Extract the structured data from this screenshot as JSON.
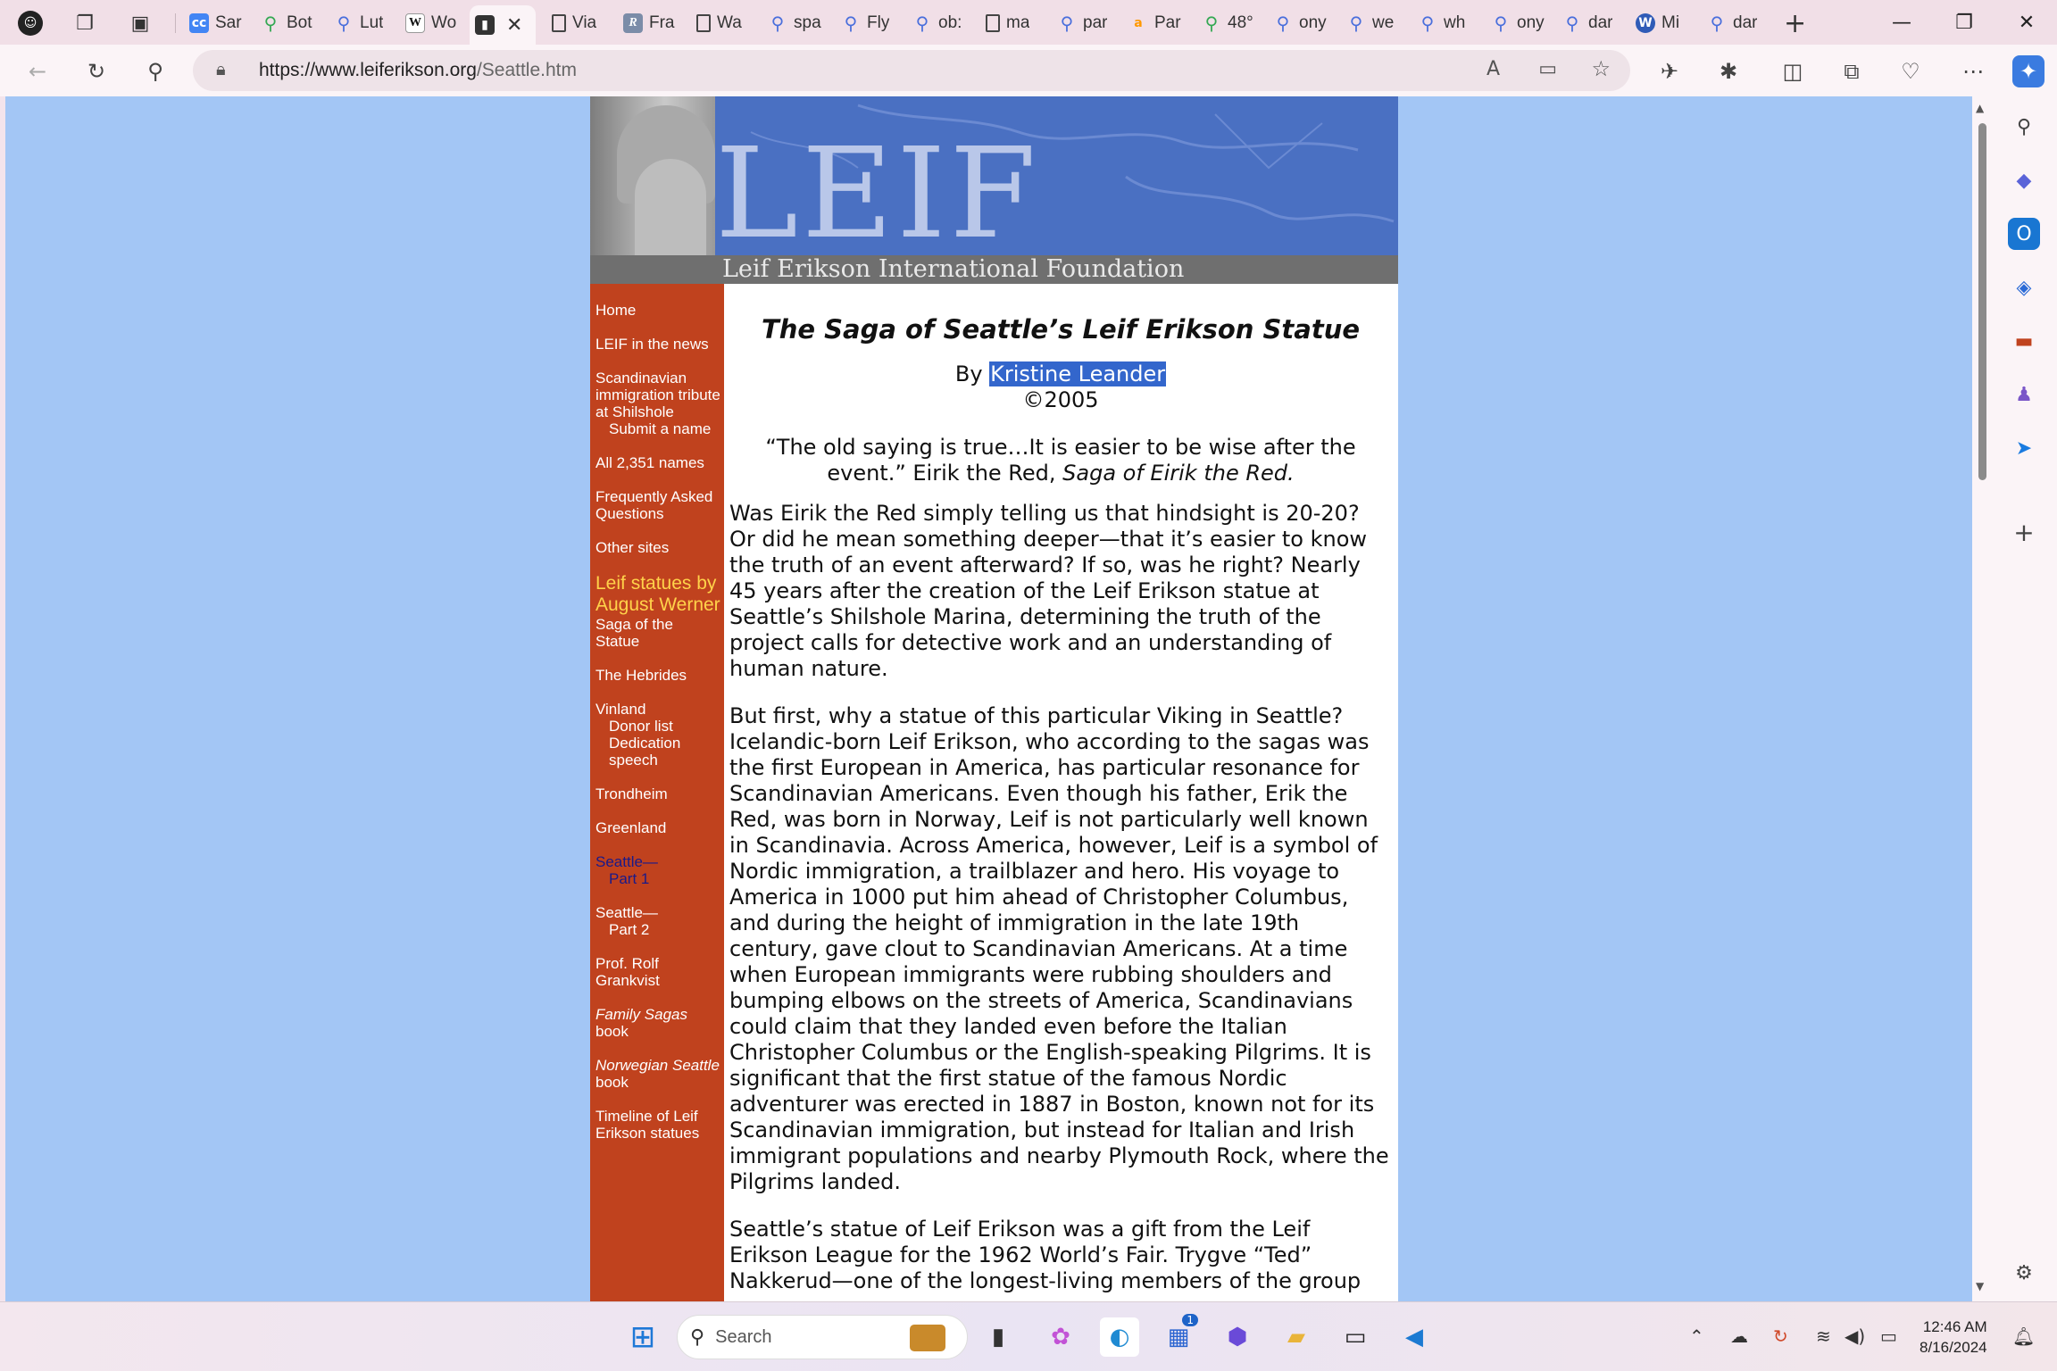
{
  "tabs": [
    {
      "label": "",
      "icon": "profile-avatar-icon"
    },
    {
      "label": "",
      "icon": "workspaces-icon"
    },
    {
      "label": "",
      "icon": "tab-actions-icon"
    },
    {
      "label": "Sar",
      "icon": "cc-icon"
    },
    {
      "label": "Bot",
      "icon": "maps-pin-icon"
    },
    {
      "label": "Lut",
      "icon": "search-icon"
    },
    {
      "label": "Wo",
      "icon": "wikipedia-icon"
    },
    {
      "label": "",
      "icon": "leif-favicon-icon",
      "active": true
    },
    {
      "label": "Via",
      "icon": "document-icon"
    },
    {
      "label": "Fra",
      "icon": "r-icon"
    },
    {
      "label": "Wa",
      "icon": "document-icon"
    },
    {
      "label": "spa",
      "icon": "search-icon"
    },
    {
      "label": "Fly",
      "icon": "search-icon"
    },
    {
      "label": "ob:",
      "icon": "search-icon"
    },
    {
      "label": "ma",
      "icon": "document-icon"
    },
    {
      "label": "par",
      "icon": "search-icon"
    },
    {
      "label": "Par",
      "icon": "amazon-icon"
    },
    {
      "label": "48°",
      "icon": "maps-pin-icon"
    },
    {
      "label": "ony",
      "icon": "search-icon"
    },
    {
      "label": "we",
      "icon": "search-icon"
    },
    {
      "label": "wh",
      "icon": "search-icon"
    },
    {
      "label": "ony",
      "icon": "search-icon"
    },
    {
      "label": "dar",
      "icon": "search-icon"
    },
    {
      "label": "Mi",
      "icon": "wordpress-icon"
    },
    {
      "label": "dar",
      "icon": "search-icon"
    }
  ],
  "browser": {
    "url_host": "https://www.leiferikson.org",
    "url_path": "/Seattle.htm"
  },
  "banner": {
    "leif": "LEIF",
    "org": "Leif Erikson International Foundation"
  },
  "nav": {
    "home": "Home",
    "news": "LEIF in the news",
    "tribute": "Scandinavian immigration tribute at Shilshole",
    "submit": "Submit a name",
    "names": "All 2,351 names",
    "faq": "Frequently Asked Questions",
    "other": "Other sites",
    "statues_heading": "Leif statues by August Werner",
    "saga": "Saga of the Statue",
    "hebrides": "The Hebrides",
    "vinland": "Vinland",
    "donor": "Donor list",
    "dedication": "Dedication speech",
    "trondheim": "Trondheim",
    "greenland": "Greenland",
    "seattle1_a": "Seattle—",
    "seattle1_b": "Part 1",
    "seattle2_a": "Seattle—",
    "seattle2_b": "Part 2",
    "grankvist": "Prof. Rolf Grankvist",
    "family_italic": "Family Sagas",
    "family_rest": " book",
    "norwegian_italic": "Norwegian Seattle",
    "norwegian_rest": " book",
    "timeline": "Timeline of Leif Erikson statues"
  },
  "article": {
    "title": "The Saga of Seattle’s Leif Erikson Statue",
    "by": "By ",
    "author": "Kristine Leander",
    "copyright": "©2005",
    "quote_text": "“The old saying is true…It is easier to be wise after the event.” Eirik the Red, ",
    "quote_source": "Saga of Eirik the Red.",
    "p1": "Was Eirik the Red simply telling us that hindsight is 20-20? Or did he mean something deeper—that it’s easier to know the truth of an event afterward? If so, was he right? Nearly 45 years after the creation of the Leif Erikson statue at Seattle’s Shilshole Marina, determining the truth of the project calls for detective work and an understanding of human nature.",
    "p2": "But first, why a statue of this particular Viking in Seattle? Icelandic-born Leif Erikson, who according to the sagas was the first European in America, has particular resonance for Scandinavian Americans. Even though his father, Erik the Red, was born in Norway, Leif is not particularly well known in Scandinavia. Across America, however, Leif is a symbol of Nordic immigration, a trailblazer and hero. His voyage to America in 1000 put him ahead of Christopher Columbus, and during the height of immigration in the late 19th century, gave clout to Scandinavian Americans. At a time when European immigrants were rubbing shoulders and bumping elbows on the streets of America, Scandinavians could claim that they landed even before the Italian Christopher Columbus or the English-speaking Pilgrims. It is significant that the first statue of the famous Nordic adventurer was erected in 1887 in Boston, known not for its Scandinavian immigration, but instead for Italian and Irish immigrant populations and nearby Plymouth Rock, where the Pilgrims landed.",
    "p3": "Seattle’s statue of Leif Erikson was a gift from the Leif Erikson League for the 1962 World’s Fair. Trygve “Ted” Nakkerud—one of the longest-living members of the group"
  },
  "taskbar": {
    "search_placeholder": "Search",
    "time": "12:46 AM",
    "date": "8/16/2024",
    "store_badge": "1"
  },
  "colors": {
    "page_bg": "#a3c6f5",
    "nav_bg": "#c0421e",
    "banner_bg": "#4a70c2",
    "highlight": "#3366cc"
  }
}
